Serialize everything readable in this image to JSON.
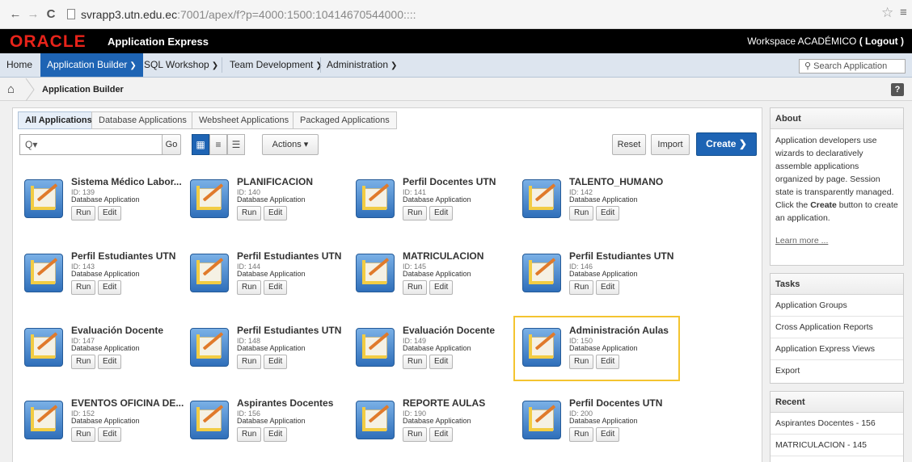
{
  "browser": {
    "back": "←",
    "forward": "→",
    "reload": "C",
    "url_host": "svrapp3.utn.edu.ec",
    "url_rest": ":7001/apex/f?p=4000:1500:10414670544000::::",
    "star": "☆",
    "menu": "≡"
  },
  "header": {
    "logo": "ORACLE",
    "product": "Application Express",
    "workspace_label": "Workspace ACADÉMICO",
    "logout": "( Logout )"
  },
  "nav": {
    "tabs": [
      {
        "label": "Home"
      },
      {
        "label": "Application Builder"
      },
      {
        "label": "SQL Workshop"
      },
      {
        "label": "Team Development"
      },
      {
        "label": "Administration"
      }
    ],
    "search_placeholder": "Search Application"
  },
  "breadcrumb": {
    "current": "Application Builder",
    "help": "?"
  },
  "subtabs": [
    {
      "label": "All Applications"
    },
    {
      "label": "Database Applications"
    },
    {
      "label": "Websheet Applications"
    },
    {
      "label": "Packaged Applications"
    }
  ],
  "toolbar": {
    "go": "Go",
    "actions": "Actions",
    "reset": "Reset",
    "import": "Import",
    "create": "Create"
  },
  "apps": [
    {
      "name": "Sistema Médico Labor...",
      "id": "ID: 139",
      "type": "Database Application"
    },
    {
      "name": "PLANIFICACION",
      "id": "ID: 140",
      "type": "Database Application"
    },
    {
      "name": "Perfil Docentes UTN",
      "id": "ID: 141",
      "type": "Database Application"
    },
    {
      "name": "TALENTO_HUMANO",
      "id": "ID: 142",
      "type": "Database Application"
    },
    {
      "name": "Perfil Estudiantes UTN",
      "id": "ID: 143",
      "type": "Database Application"
    },
    {
      "name": "Perfil Estudiantes UTN",
      "id": "ID: 144",
      "type": "Database Application"
    },
    {
      "name": "MATRICULACION",
      "id": "ID: 145",
      "type": "Database Application"
    },
    {
      "name": "Perfil Estudiantes UTN",
      "id": "ID: 146",
      "type": "Database Application"
    },
    {
      "name": "Evaluación Docente",
      "id": "ID: 147",
      "type": "Database Application"
    },
    {
      "name": "Perfil Estudiantes UTN",
      "id": "ID: 148",
      "type": "Database Application"
    },
    {
      "name": "Evaluación Docente",
      "id": "ID: 149",
      "type": "Database Application"
    },
    {
      "name": "Administración Aulas",
      "id": "ID: 150",
      "type": "Database Application"
    },
    {
      "name": "EVENTOS OFICINA DE...",
      "id": "ID: 152",
      "type": "Database Application"
    },
    {
      "name": "Aspirantes Docentes",
      "id": "ID: 156",
      "type": "Database Application"
    },
    {
      "name": "REPORTE AULAS",
      "id": "ID: 190",
      "type": "Database Application"
    },
    {
      "name": "Perfil Docentes UTN",
      "id": "ID: 200",
      "type": "Database Application"
    }
  ],
  "app_buttons": {
    "run": "Run",
    "edit": "Edit"
  },
  "about": {
    "title": "About",
    "text_1": "Application developers use wizards to declaratively assemble applications organized by page. Session state is transparently managed. Click the ",
    "text_bold": "Create",
    "text_2": " button to create an application.",
    "learn_more": "Learn more ..."
  },
  "tasks": {
    "title": "Tasks",
    "items": [
      "Application Groups",
      "Cross Application Reports",
      "Application Express Views",
      "Export"
    ]
  },
  "recent": {
    "title": "Recent",
    "items": [
      "Aspirantes Docentes - 156",
      "MATRICULACION - 145"
    ]
  },
  "colors": {
    "accent": "#1e64b4",
    "oracle_red": "#e8231a",
    "selected_border": "#f4c430"
  },
  "icons": {
    "home": "home-icon",
    "search": "search-icon",
    "grid": "grid-view-icon",
    "list": "list-view-icon",
    "detail": "detail-view-icon"
  }
}
